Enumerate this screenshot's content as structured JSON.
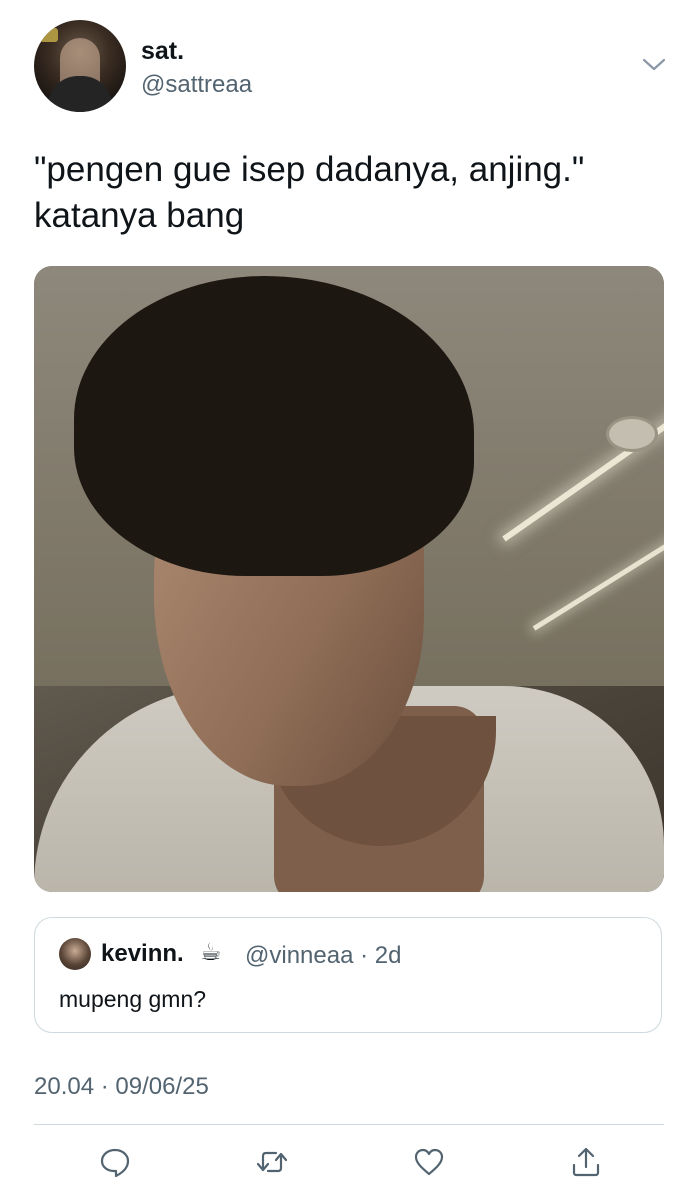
{
  "tweet": {
    "display_name": "sat.",
    "handle": "@sattreaa",
    "text_lines": [
      "\"pengen gue isep dadanya, anjing.\"",
      "katanya bang"
    ],
    "timestamp": "20.04 · 09/06/25"
  },
  "quoted_tweet": {
    "display_name": "kevinn.",
    "emoji": "☕",
    "handle_time": "@vinneaa · 2d",
    "text": "mupeng gmn?"
  },
  "actions": [
    {
      "icon": "reply-icon"
    },
    {
      "icon": "retweet-icon"
    },
    {
      "icon": "like-icon"
    },
    {
      "icon": "share-icon"
    }
  ],
  "colors": {
    "primary_text": "#0f1419",
    "secondary_text": "#536471",
    "border": "#cfd9de",
    "icon": "#536471"
  }
}
